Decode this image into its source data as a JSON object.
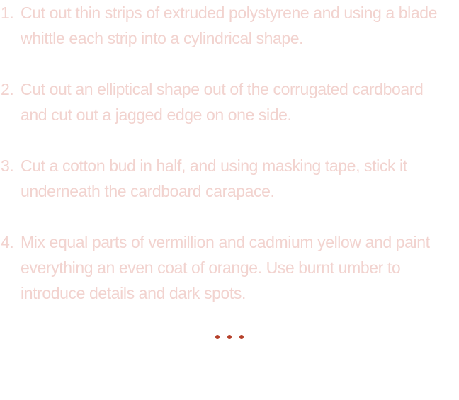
{
  "steps": [
    {
      "number": "1.",
      "text": "Cut out thin strips of extruded polystyrene and using a blade whittle each strip into a cylindrical shape."
    },
    {
      "number": "2.",
      "text": "Cut out an elliptical shape out of the corrugated cardboard and cut out a jagged edge on one side."
    },
    {
      "number": "3.",
      "text": "Cut a cotton bud in half, and using masking tape, stick it underneath the cardboard carapace."
    },
    {
      "number": "4.",
      "text": "Mix equal parts of vermillion and cadmium yellow and paint everything an even coat of orange. Use burnt umber to introduce details and dark spots."
    }
  ],
  "colors": {
    "text": "#f2d3cf",
    "dots": "#b5402a"
  },
  "separator_icon": "ellipsis-dots"
}
